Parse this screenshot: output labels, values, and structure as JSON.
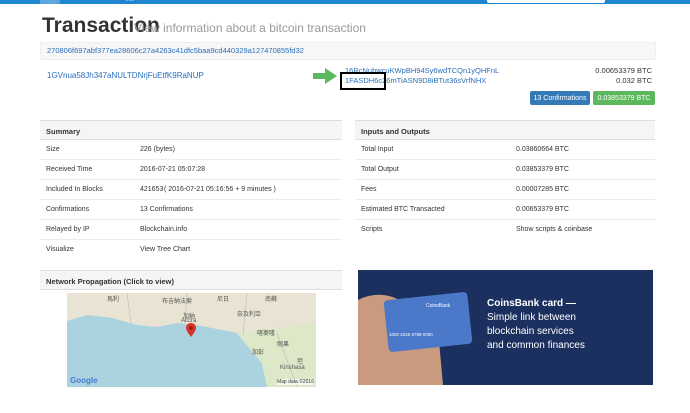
{
  "header": {
    "logo_text": "info"
  },
  "page": {
    "title": "Transaction",
    "subtitle": "View information about a bitcoin transaction"
  },
  "tx": {
    "hash": "270806f697abf377ea28606c27a4263c41dfc5baa9cd440329a127470855fd32",
    "from": "1GVnua58Jh347aNULTDNrjFuEtfK9RaNUP",
    "outputs": [
      {
        "address": "16RcNubwcuKWpBH94Sy6wdTCQn1yQHFnL",
        "amount": "0.00653379 BTC"
      },
      {
        "address": "1FASDH6c26mTiASN9D8iBTut36sVrfNHX",
        "amount": "0.032 BTC"
      }
    ],
    "confirmations_button": "13 Confirmations",
    "total_button": "0.03853379 BTC"
  },
  "summary": {
    "heading": "Summary",
    "rows": [
      {
        "label": "Size",
        "value": "226 (bytes)"
      },
      {
        "label": "Received Time",
        "value": "2016-07-21 05:07:28"
      },
      {
        "label": "Included In Blocks",
        "link": "421653",
        "value": "( 2016-07-21 05:16:56 + 9 minutes )"
      },
      {
        "label": "Confirmations",
        "value": "13 Confirmations"
      },
      {
        "label": "Relayed by IP",
        "value": "Blockchain.info"
      },
      {
        "label": "Visualize",
        "value": "View Tree Chart"
      }
    ]
  },
  "io": {
    "heading": "Inputs and Outputs",
    "rows": [
      {
        "label": "Total Input",
        "value": "0.03860664 BTC"
      },
      {
        "label": "Total Output",
        "value": "0.03853379 BTC"
      },
      {
        "label": "Fees",
        "value": "0.00007285 BTC"
      },
      {
        "label": "Estimated BTC Transacted",
        "value": "0.00653379 BTC"
      },
      {
        "label": "Scripts",
        "value": "Show scripts & coinbase"
      }
    ]
  },
  "network": {
    "heading": "Network Propagation (Click to view)",
    "map_labels": [
      "馬利",
      "布吉納法索",
      "尼日",
      "奈及利亞",
      "加納",
      "Accra",
      "喀麥隆",
      "加彭",
      "剛果",
      "Kinshasa",
      "南蘇",
      "坦"
    ],
    "google": "Google",
    "copyright": "Map data ©2016"
  },
  "ad": {
    "card_brand": "CoinsBank",
    "card_number": "1000 2345 6789 0000",
    "headline": "CoinsBank card —",
    "line2": "Simple link between",
    "line3": "blockchain services",
    "line4": "and common finances"
  }
}
